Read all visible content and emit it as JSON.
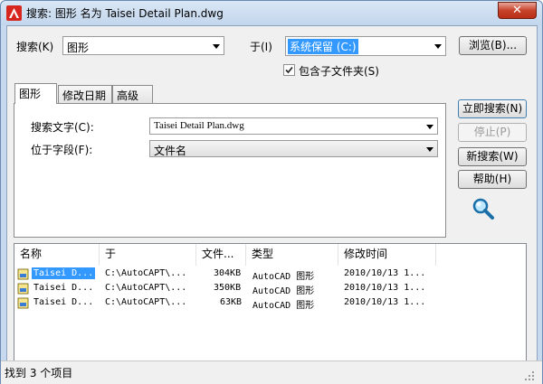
{
  "window": {
    "title": "搜索: 图形 名为 Taisei Detail Plan.dwg",
    "close_glyph": "✕"
  },
  "search": {
    "search_label": "搜索(K)",
    "search_value": "图形",
    "in_label": "于(I)",
    "in_value": "系统保留 (C:)",
    "browse_button": "浏览(B)...",
    "subfolders_label": "包含子文件夹(S)",
    "subfolders_checked": true
  },
  "tabs": [
    {
      "label": "图形"
    },
    {
      "label": "修改日期"
    },
    {
      "label": "高级"
    }
  ],
  "drawing_tab": {
    "search_text_label": "搜索文字(C):",
    "search_text_value": "Taisei Detail Plan.dwg",
    "field_label": "位于字段(F):",
    "field_value": "文件名"
  },
  "actions": {
    "find_now": "立即搜索(N)",
    "stop": "停止(P)",
    "new_search": "新搜索(W)",
    "help": "帮助(H)"
  },
  "results": {
    "columns": [
      "名称",
      "于",
      "文件...",
      "类型",
      "修改时间"
    ],
    "rows": [
      {
        "name": "Taisei D...",
        "in": "C:\\AutoCAPT\\...",
        "size": "304KB",
        "type": "AutoCAD 图形",
        "modified": "2010/10/13 1..."
      },
      {
        "name": "Taisei D...",
        "in": "C:\\AutoCAPT\\...",
        "size": "350KB",
        "type": "AutoCAD 图形",
        "modified": "2010/10/13 1..."
      },
      {
        "name": "Taisei D...",
        "in": "C:\\AutoCAPT\\...",
        "size": "63KB",
        "type": "AutoCAD 图形",
        "modified": "2010/10/13 1..."
      }
    ]
  },
  "status": {
    "text": "找到 3 个项目"
  },
  "colors": {
    "selection": "#3399ff",
    "app_icon": "#d7261e"
  }
}
